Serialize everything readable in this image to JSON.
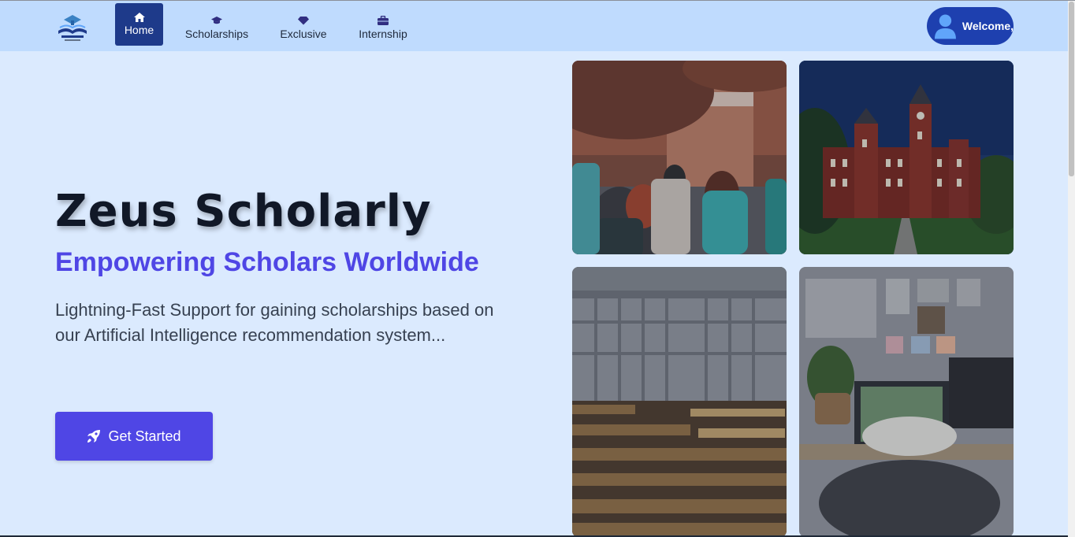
{
  "app": {
    "logo_text": "Zeus Scholarly"
  },
  "nav": {
    "items": [
      {
        "label": "Home",
        "icon": "home-icon",
        "active": true
      },
      {
        "label": "Scholarships",
        "icon": "graduation-cap-icon",
        "active": false
      },
      {
        "label": "Exclusive",
        "icon": "gem-icon",
        "active": false
      },
      {
        "label": "Internship",
        "icon": "briefcase-icon",
        "active": false
      }
    ],
    "welcome_label": "Welcome,",
    "welcome_icon": "user-avatar-icon"
  },
  "hero": {
    "title": "Zeus Scholarly",
    "subtitle": "Empowering Scholars Worldwide",
    "description": "Lightning-Fast Support for gaining scholarships based on our Artificial Intelligence recommendation system...",
    "cta_label": "Get Started",
    "cta_icon": "rocket-icon"
  },
  "gallery": {
    "images": [
      {
        "name": "students-walking-photo"
      },
      {
        "name": "university-building-photo"
      },
      {
        "name": "library-bookshelves-photo"
      },
      {
        "name": "study-desk-photo"
      }
    ]
  },
  "colors": {
    "page_bg": "#dbeafe",
    "navbar_bg": "#bfdbfe",
    "nav_active_bg": "#1e3a8a",
    "welcome_bg": "#1e40af",
    "accent": "#4f46e5",
    "title": "#111827"
  }
}
